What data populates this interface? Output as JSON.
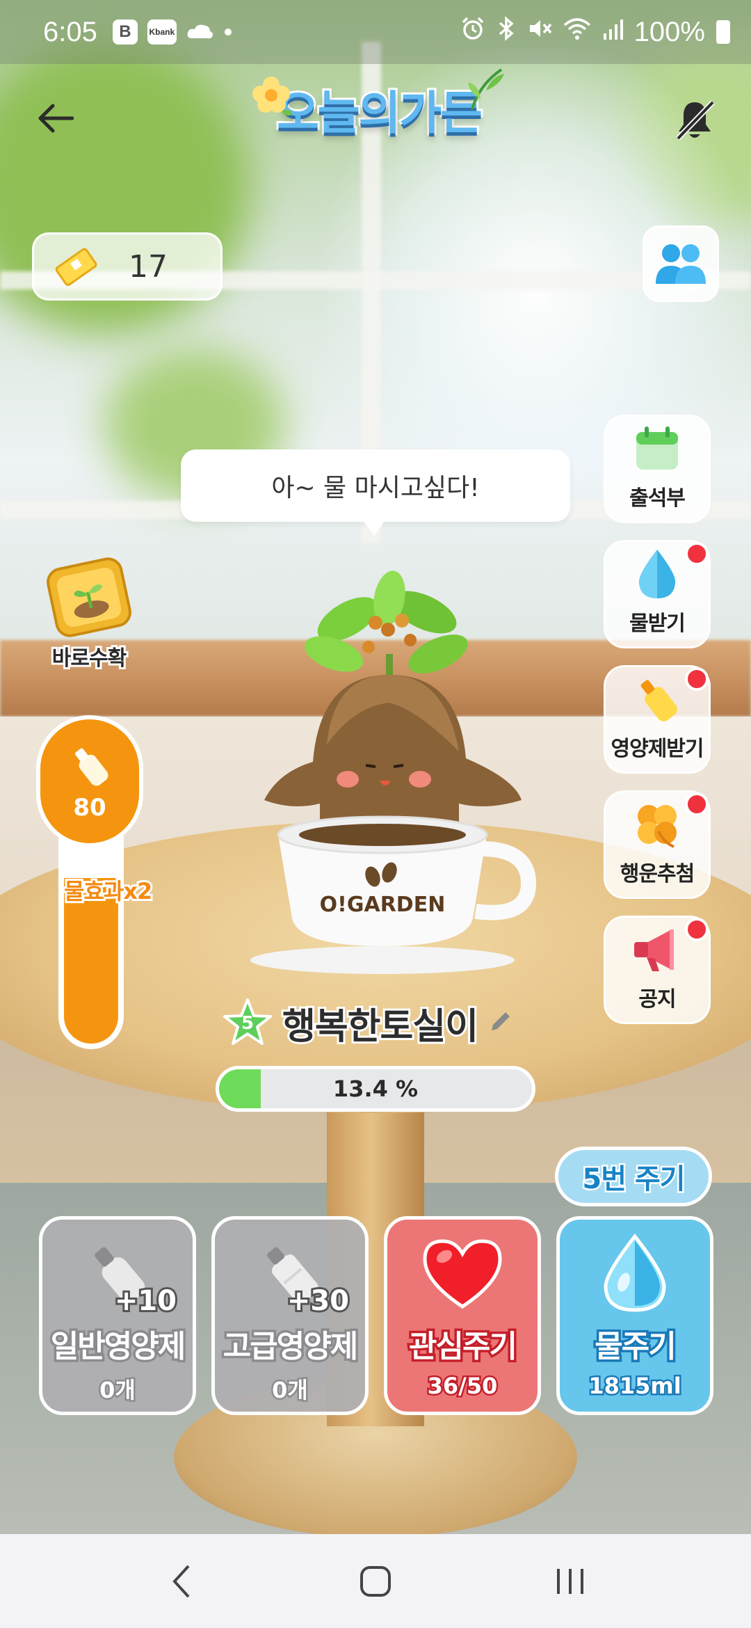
{
  "status_bar": {
    "time": "6:05",
    "box_icon_text": "B",
    "kbank_text": "Kbank",
    "battery_text": "100%"
  },
  "header": {
    "logo_text": "오늘의가든",
    "back_icon": "back-arrow-icon",
    "notification_icon": "bell-off-icon"
  },
  "ticket": {
    "count": "17"
  },
  "speech_bubble": "아~ 물 마시고싶다!",
  "side_menu": [
    {
      "label": "출석부",
      "icon": "calendar-icon",
      "badge": false
    },
    {
      "label": "물받기",
      "icon": "water-drop-icon",
      "badge": true
    },
    {
      "label": "영양제받기",
      "icon": "nutrient-bottle-icon",
      "badge": true
    },
    {
      "label": "행운추첨",
      "icon": "clover-icon",
      "badge": true
    },
    {
      "label": "공지",
      "icon": "megaphone-icon",
      "badge": true
    }
  ],
  "instant_harvest": {
    "label": "바로수확"
  },
  "gauge": {
    "value": "80",
    "level_fraction": 0.74,
    "effect_label": "물효과x2",
    "color": "#f5950f"
  },
  "plant": {
    "pot_text": "O!GARDEN",
    "level": "5",
    "name": "행복한토실이"
  },
  "progress": {
    "text": "13.4 %",
    "value": 13.4
  },
  "water_five_button": "5번 주기",
  "actions": [
    {
      "title": "일반영양제",
      "sub": "0개",
      "plus": "+10"
    },
    {
      "title": "고급영양제",
      "sub": "0개",
      "plus": "+30"
    },
    {
      "title": "관심주기",
      "sub": "36/50"
    },
    {
      "title": "물주기",
      "sub": "1815ml"
    }
  ],
  "colors": {
    "accent_orange": "#f5950f",
    "water_blue": "#67c6eb",
    "heart_red": "#ec7676",
    "badge_red": "#f0323e",
    "progress_green": "#6fdb5a"
  }
}
